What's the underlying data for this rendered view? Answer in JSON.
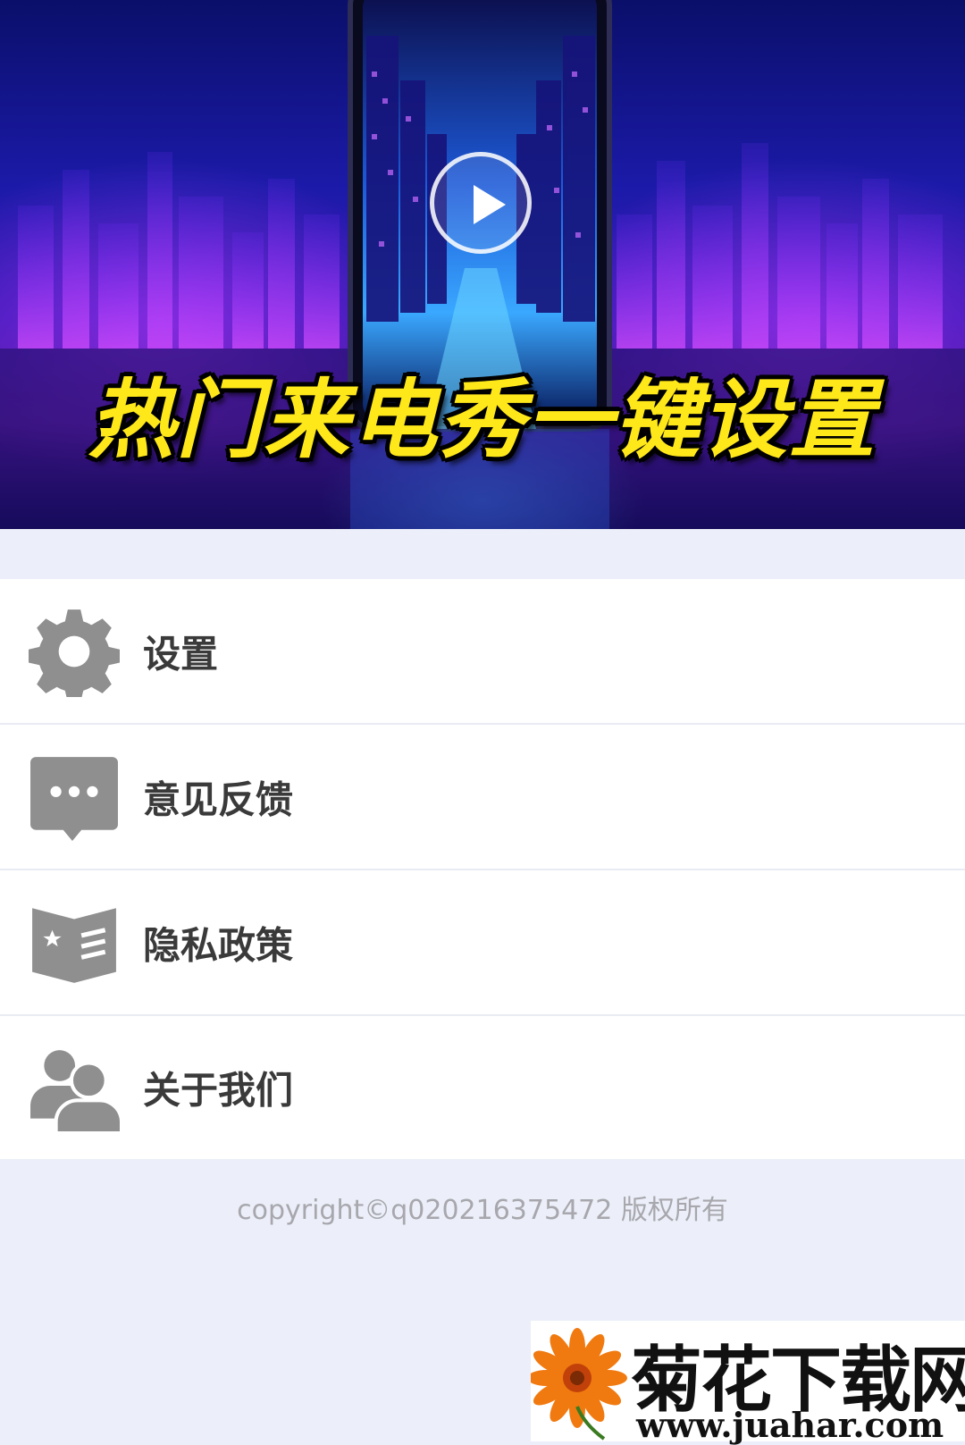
{
  "banner": {
    "title": "热门来电秀一键设置"
  },
  "menu": {
    "items": [
      {
        "label": "设置",
        "icon": "gear-icon"
      },
      {
        "label": "意见反馈",
        "icon": "chat-bubble-icon"
      },
      {
        "label": "隐私政策",
        "icon": "policy-book-icon"
      },
      {
        "label": "关于我们",
        "icon": "users-icon"
      }
    ]
  },
  "footer": {
    "copyright": "copyright©q020216375472 版权所有"
  },
  "watermark": {
    "name": "菊花下载网",
    "url": "www.juahar.com"
  },
  "colors": {
    "page_background": "#eceff9",
    "icon_gray": "#8f8f8f",
    "banner_title": "#ffe81a",
    "label_text": "#3a3a3a",
    "copyright_text": "#a7a7ad"
  }
}
